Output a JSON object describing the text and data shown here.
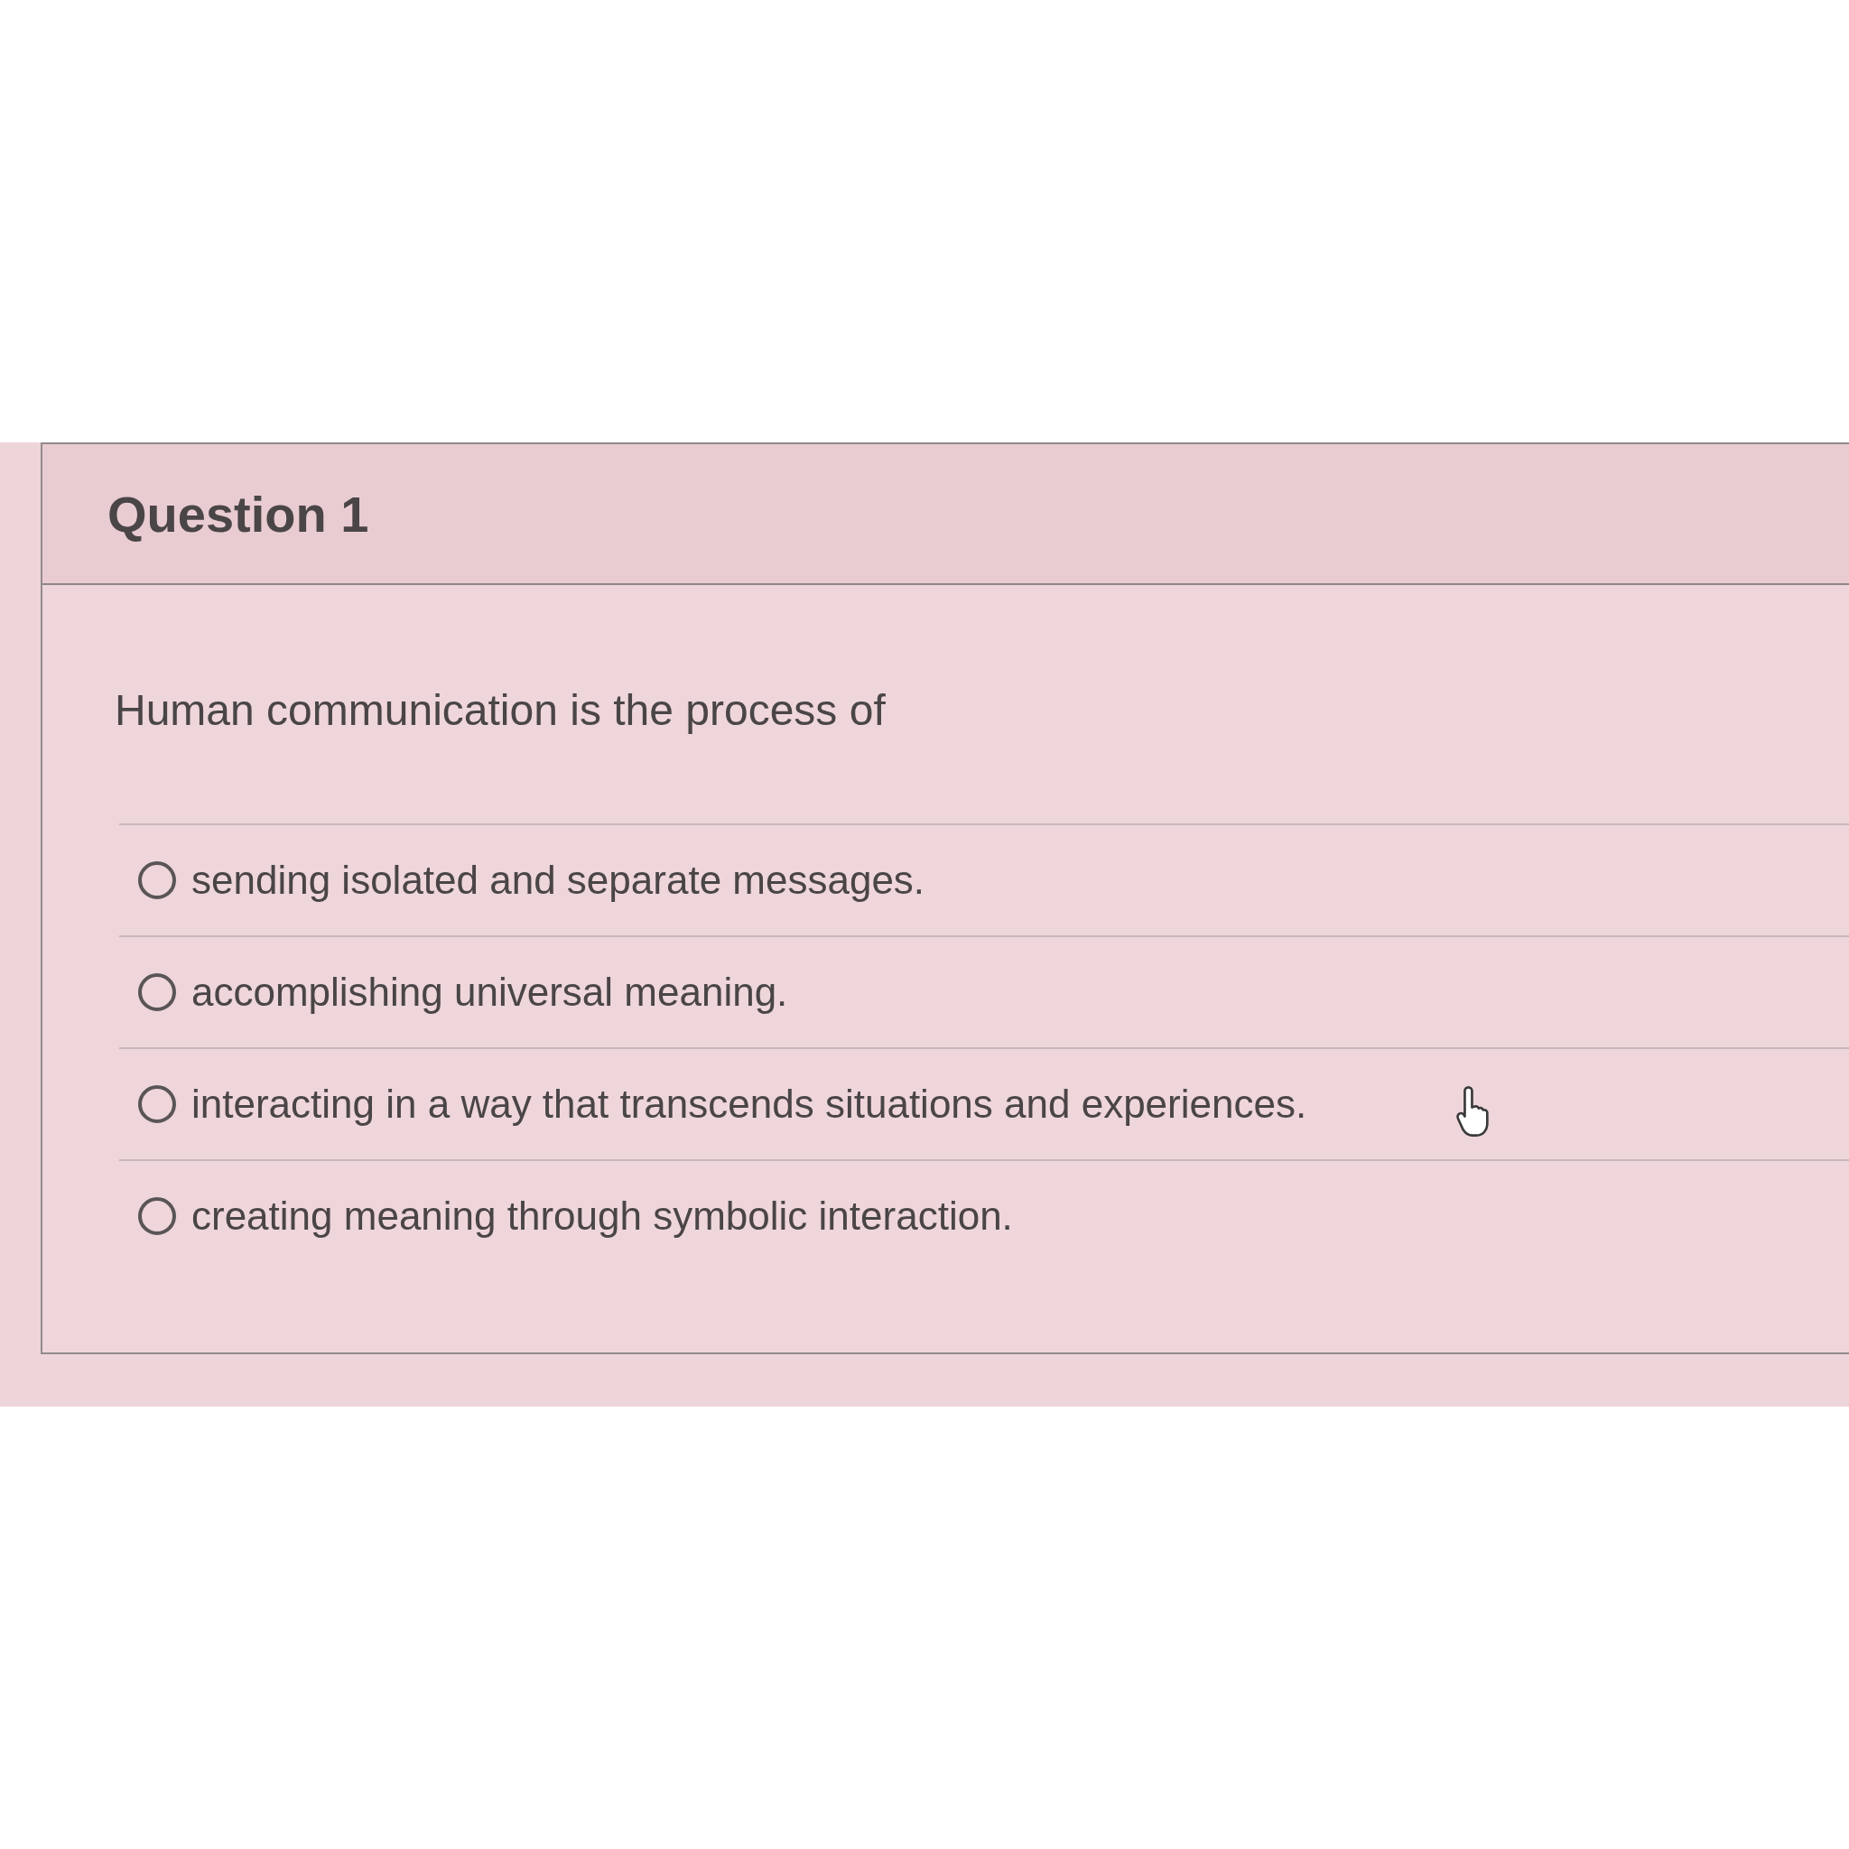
{
  "question": {
    "title": "Question 1",
    "prompt": "Human communication is the process of",
    "options": [
      {
        "label": "sending isolated and separate messages.",
        "selected": false
      },
      {
        "label": "accomplishing universal meaning.",
        "selected": false
      },
      {
        "label": "interacting in a way that transcends situations and experiences.",
        "selected": false
      },
      {
        "label": "creating meaning through symbolic interaction.",
        "selected": false
      }
    ]
  }
}
